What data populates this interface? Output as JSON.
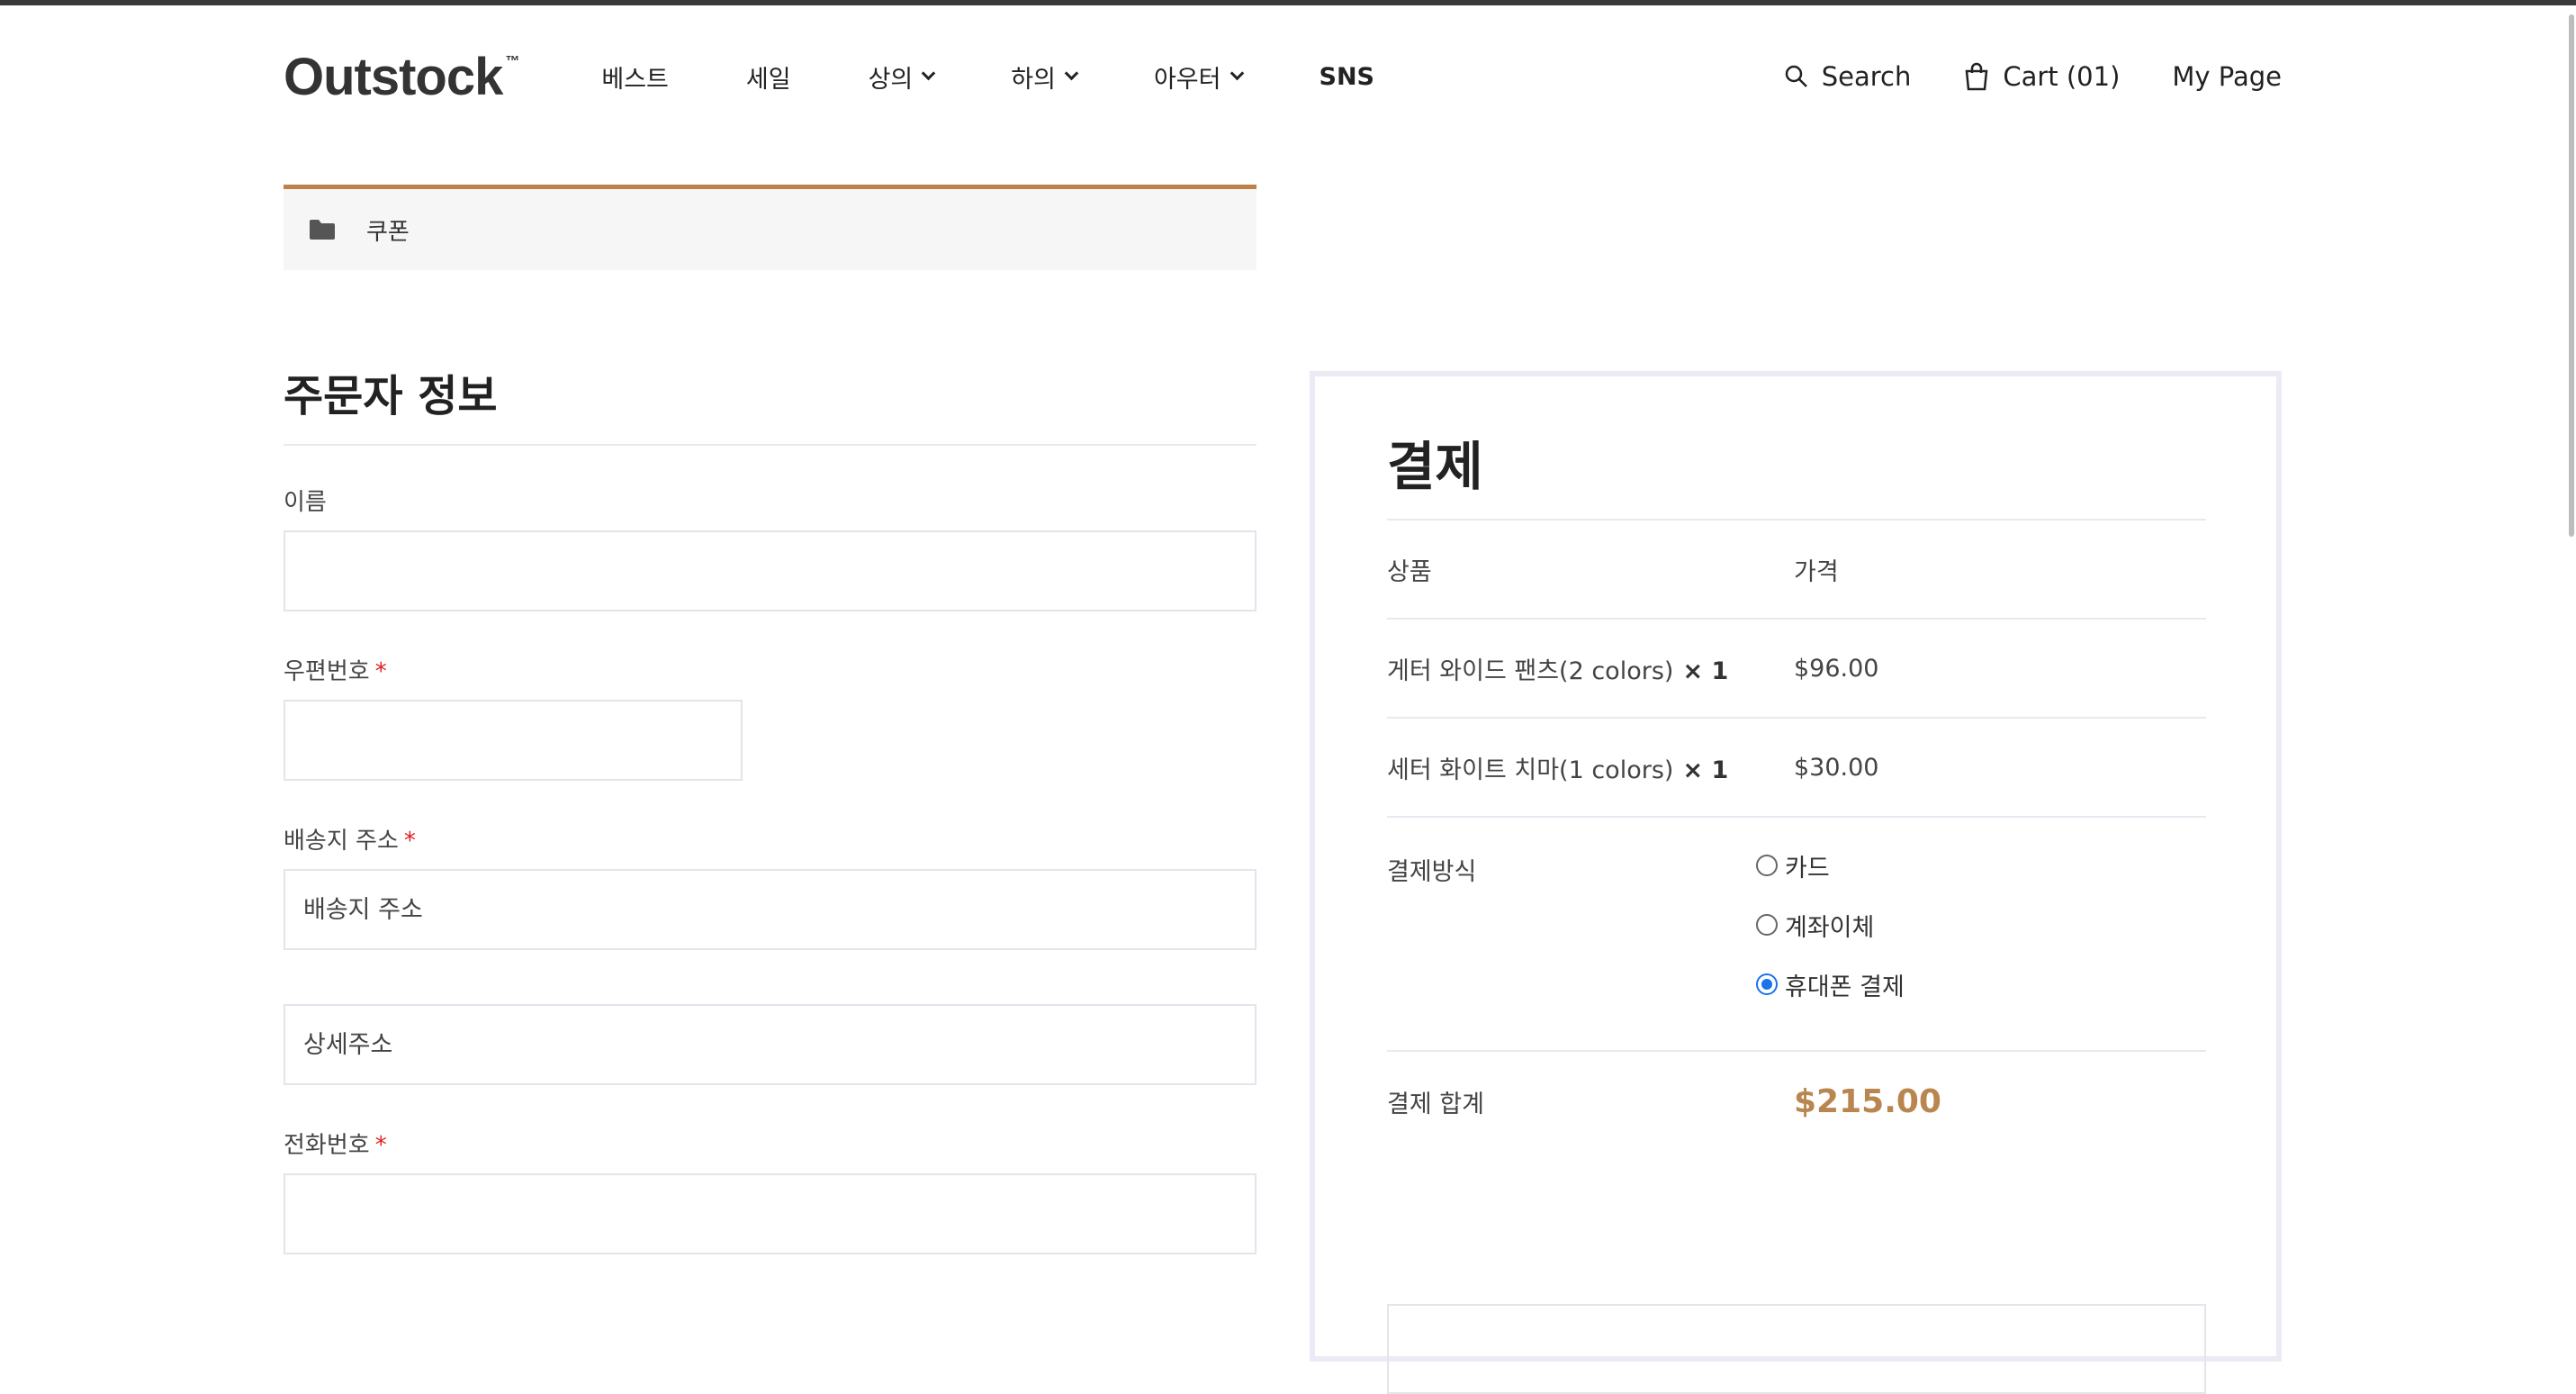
{
  "header": {
    "logo": "Outstock",
    "logo_tm": "™",
    "nav": [
      {
        "label": "베스트",
        "dropdown": false
      },
      {
        "label": "세일",
        "dropdown": false
      },
      {
        "label": "상의",
        "dropdown": true
      },
      {
        "label": "하의",
        "dropdown": true
      },
      {
        "label": "아우터",
        "dropdown": true
      },
      {
        "label": "SNS",
        "dropdown": false
      }
    ],
    "search_label": "Search",
    "cart_label": "Cart (01)",
    "mypage_label": "My Page"
  },
  "coupon_bar": {
    "label": "쿠폰",
    "accent_color": "#c0804a"
  },
  "orderer": {
    "title": "주문자 정보",
    "name_label": "이름",
    "postcode_label": "우편번호",
    "address_label": "배송지 주소",
    "address_placeholder": "배송지 주소",
    "detail_placeholder": "상세주소",
    "phone_label": "전화번호",
    "required_mark": "*"
  },
  "payment": {
    "title": "결제",
    "col_product": "상품",
    "col_price": "가격",
    "items": [
      {
        "name": "게터 와이드 팬츠(2 colors)",
        "qty": "× 1",
        "price": "$96.00"
      },
      {
        "name": "세터 화이트 치마(1 colors)",
        "qty": "× 1",
        "price": "$30.00"
      }
    ],
    "method_label": "결제방식",
    "methods": [
      {
        "label": "카드",
        "checked": false
      },
      {
        "label": "계좌이체",
        "checked": false
      },
      {
        "label": "휴대폰 결제",
        "checked": true
      }
    ],
    "total_label": "결제 합계",
    "total_value": "$215.00",
    "total_color": "#b8864e"
  }
}
